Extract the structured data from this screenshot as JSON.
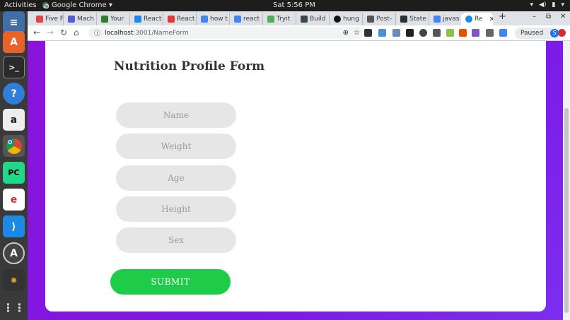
{
  "topbar": {
    "activities": "Activities",
    "app_name": "Google Chrome ▾",
    "clock": "Sat  5:56 PM"
  },
  "tabs": [
    {
      "label": "Five F",
      "color": "#d44"
    },
    {
      "label": "Mach",
      "color": "#5b5bd6"
    },
    {
      "label": "Your",
      "color": "#2e7d32"
    },
    {
      "label": "React",
      "color": "#1e88e5"
    },
    {
      "label": "React",
      "color": "#e53935"
    },
    {
      "label": "how t",
      "color": "#4285f4"
    },
    {
      "label": "react",
      "color": "#4285f4"
    },
    {
      "label": "Tryit",
      "color": "#4caf50"
    },
    {
      "label": "Build",
      "color": "#37474f"
    },
    {
      "label": "hung",
      "color": "#111"
    },
    {
      "label": "Post-",
      "color": "#555"
    },
    {
      "label": "State",
      "color": "#263238"
    },
    {
      "label": "javas",
      "color": "#4285f4"
    },
    {
      "label": "Re",
      "color": "#1e88e5",
      "active": true
    }
  ],
  "toolbar": {
    "url_host": "localhost",
    "url_path": ":3001/NameForm",
    "paused_label": "Paused",
    "avatar_letter": "S"
  },
  "form": {
    "title": "Nutrition Profile Form",
    "fields": [
      {
        "placeholder": "Name"
      },
      {
        "placeholder": "Weight"
      },
      {
        "placeholder": "Age"
      },
      {
        "placeholder": "Height"
      },
      {
        "placeholder": "Sex"
      }
    ],
    "submit_label": "SUBMIT"
  },
  "colors": {
    "submit": "#1fcc4a",
    "field_bg": "#e6e6e6",
    "page_bg": "#8a14d9"
  }
}
